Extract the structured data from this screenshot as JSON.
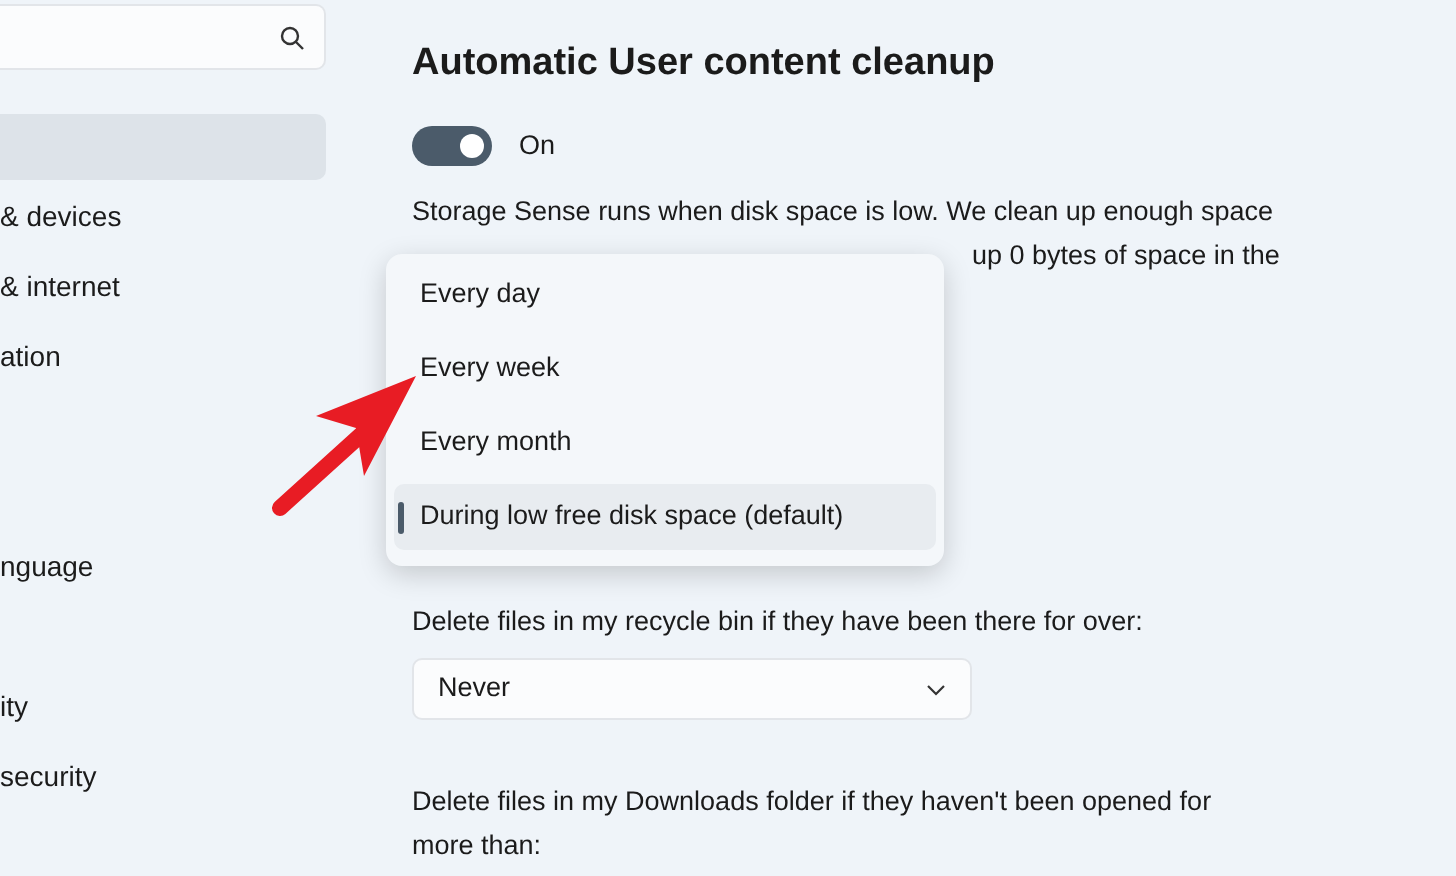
{
  "sidebar": {
    "items": [
      {
        "selected": true
      },
      {
        "label": "& devices",
        "selected": false
      },
      {
        "label": "& internet",
        "selected": false
      },
      {
        "label": "ation",
        "selected": false
      },
      {
        "label": "nguage",
        "selected": false
      },
      {
        "label": "ity",
        "selected": false
      },
      {
        "label": "security",
        "selected": false
      }
    ]
  },
  "content": {
    "title": "Automatic User content cleanup",
    "toggle": {
      "on": true,
      "label": "On"
    },
    "description": "Storage Sense runs when disk space is low. We clean up enough space",
    "description_continued": "up 0 bytes of space in the",
    "schedule_menu": [
      {
        "label": "Every day",
        "selected": false
      },
      {
        "label": "Every week",
        "selected": false
      },
      {
        "label": "Every month",
        "selected": false
      },
      {
        "label": "During low free disk space (default)",
        "selected": true
      }
    ],
    "recycle_label": "Delete files in my recycle bin if they have been there for over:",
    "recycle_value": "Never",
    "downloads_label": "Delete files in my Downloads folder if they haven't been opened for more than:"
  }
}
